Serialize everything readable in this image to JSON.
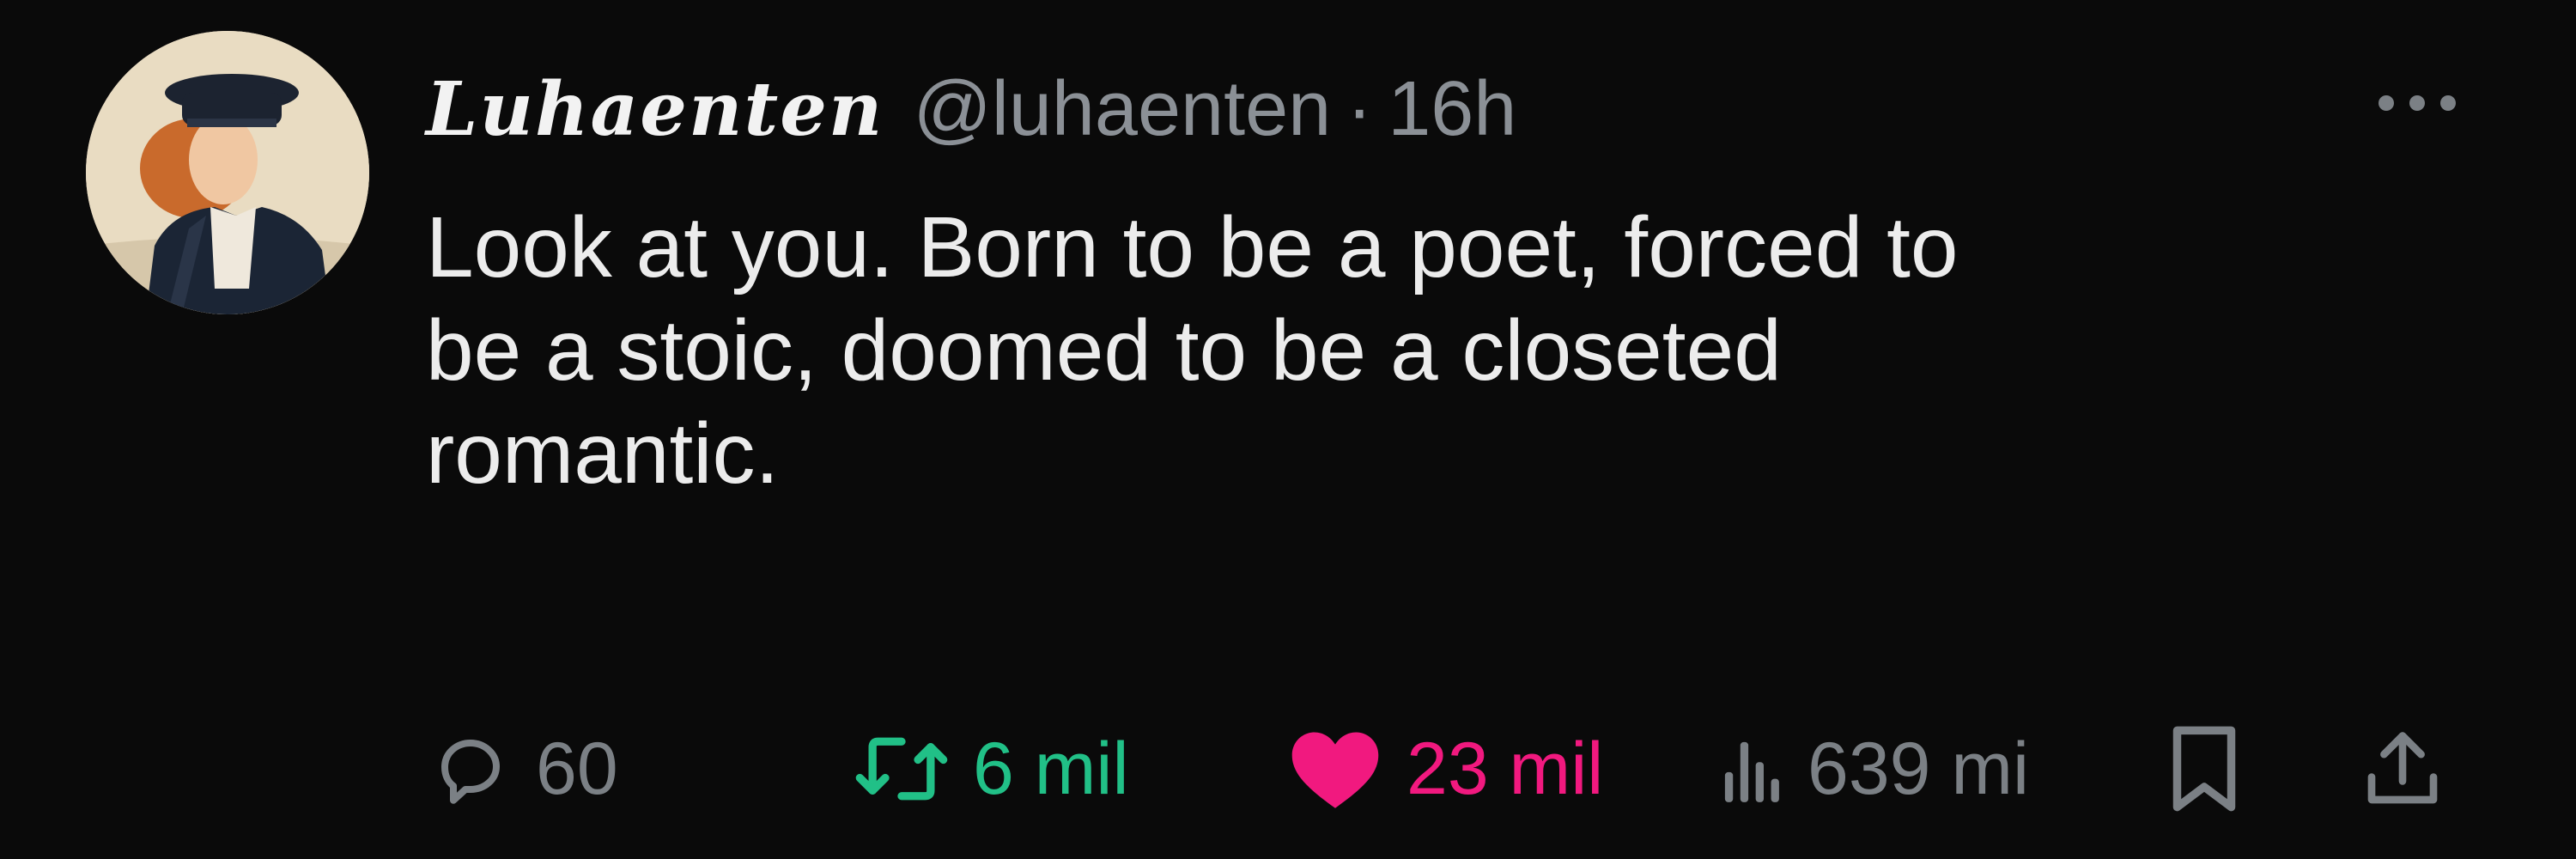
{
  "author": {
    "display_name": "Luhaenten",
    "handle": "@luhaenten",
    "separator": "·",
    "time": "16h",
    "avatar_icon": "portrait-avatar"
  },
  "tweet": {
    "lines": [
      "Look at you. Born to be a poet, forced to",
      "be a stoic, doomed to be a closeted",
      "romantic."
    ]
  },
  "actions": {
    "replies": "60",
    "retweets": "6 mil",
    "likes": "23 mil",
    "views": "639 mi",
    "liked": true
  },
  "colors": {
    "background": "#0a0a0a",
    "text": "#ececec",
    "muted": "#7b8085",
    "retweet": "#21c087",
    "like": "#f1197f"
  },
  "icons": {
    "more": "more-horizontal-icon",
    "reply": "reply-bubble-icon",
    "retweet": "retweet-icon",
    "like": "heart-filled-icon",
    "views": "views-chart-icon",
    "bookmark": "bookmark-icon",
    "share": "share-icon"
  }
}
